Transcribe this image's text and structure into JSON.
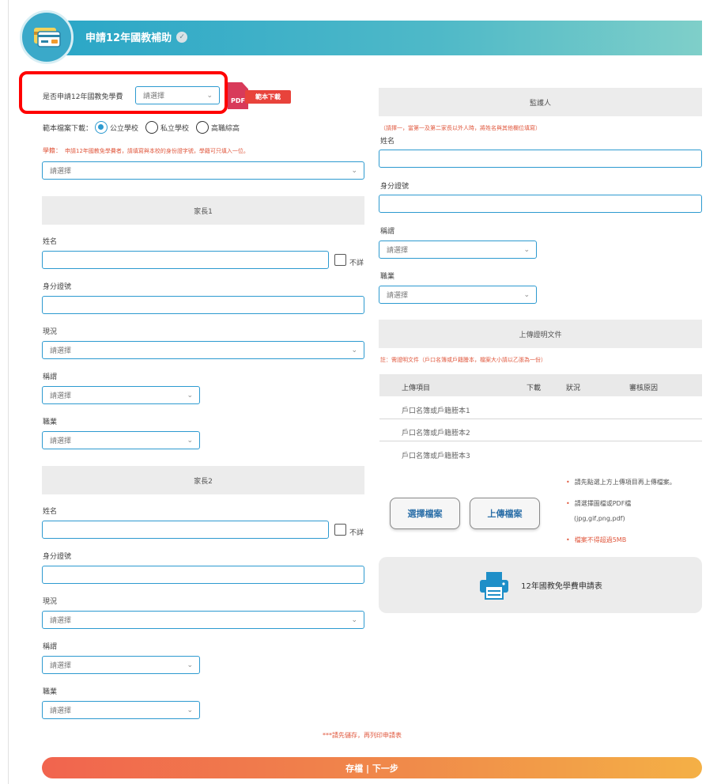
{
  "header": {
    "title": "申請12年國教補助"
  },
  "apply_row": {
    "label": "是否申請12年國教免學費",
    "select_value": "請選擇",
    "pdf_icon": "PDF",
    "download_label": "範本下載"
  },
  "template_row": {
    "label": "範本檔案下載：",
    "options": [
      "公立學校",
      "私立學校",
      "高職綜高"
    ],
    "selected": 0
  },
  "student": {
    "label": "學籍：",
    "note": "申請12年國教免學費者，請填寫與本校的身份證字號，學籍可只填入一位。",
    "select_value": "請選擇"
  },
  "household1": {
    "title": "家長1",
    "name_label": "姓名",
    "unknown_label": "不詳",
    "id_label": "身分證號",
    "status_label": "現況",
    "status_value": "請選擇",
    "relation_label": "稱謂",
    "relation_value": "請選擇",
    "job_label": "職業",
    "job_value": "請選擇"
  },
  "household2": {
    "title": "家長2",
    "name_label": "姓名",
    "unknown_label": "不詳",
    "id_label": "身分證號",
    "status_label": "現況",
    "status_value": "請選擇",
    "relation_label": "稱謂",
    "relation_value": "請選擇",
    "job_label": "職業",
    "job_value": "請選擇"
  },
  "guardian": {
    "title": "監護人",
    "note": "（請擇一，當第一及第二家長以外人時，將姓名與其他欄位填寫）",
    "name_label": "姓名",
    "id_label": "身分證號",
    "relation_label": "稱謂",
    "relation_value": "請選擇",
    "job_label": "職業",
    "job_value": "請選擇"
  },
  "upload": {
    "title": "上傳證明文件",
    "note": "註：需證明文件（戶口名簿或戶籍謄本，檔案大小請以乙張為一份）",
    "columns": [
      "上傳項目",
      "下載",
      "狀況",
      "審核原因"
    ],
    "rows": [
      "戶口名簿或戶籍謄本1",
      "戶口名簿或戶籍謄本2",
      "戶口名簿或戶籍謄本3"
    ],
    "choose_button": "選擇檔案",
    "upload_button": "上傳檔案",
    "tips": [
      "請先點選上方上傳項目再上傳檔案。",
      "請選擇圖檔或PDF檔",
      "(jpg,gif,png,pdf)",
      "檔案不得超過5MB"
    ]
  },
  "print_card": {
    "label": "12年國教免學費申請表"
  },
  "footer": {
    "notice": "***請先儲存，再列印申請表",
    "save_button": "存檔 | 下一步"
  }
}
